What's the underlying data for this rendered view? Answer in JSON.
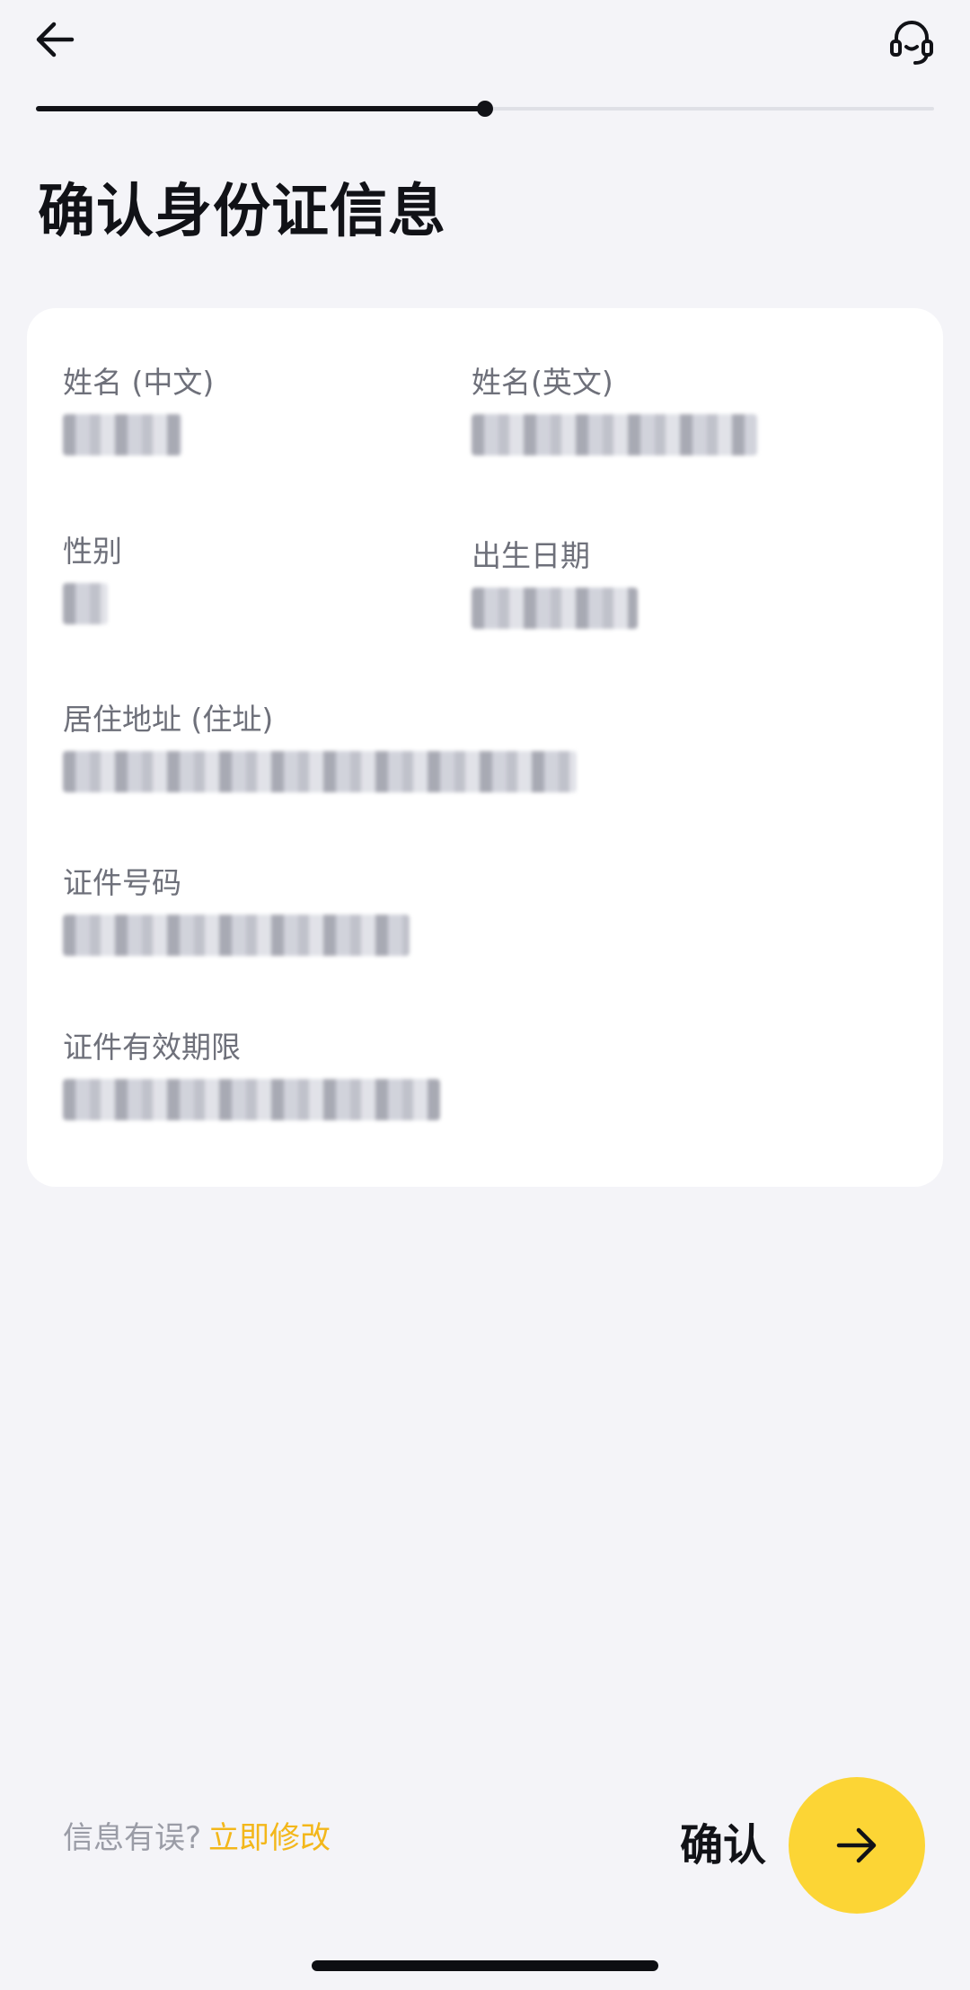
{
  "header": {
    "back_icon": "arrow-left-icon",
    "support_icon": "headset-icon"
  },
  "progress": {
    "fraction": 0.5
  },
  "page_title": "确认身份证信息",
  "fields": {
    "name_cn": {
      "label": "姓名 (中文)",
      "value": ""
    },
    "name_en": {
      "label": "姓名(英文)",
      "value": ""
    },
    "gender": {
      "label": "性别",
      "value": ""
    },
    "birth_date": {
      "label": "出生日期",
      "value": ""
    },
    "address": {
      "label": "居住地址 (住址)",
      "value": ""
    },
    "id_number": {
      "label": "证件号码",
      "value": ""
    },
    "validity": {
      "label": "证件有效期限",
      "value": ""
    }
  },
  "footer": {
    "hint": "信息有误?",
    "edit_link": "立即修改",
    "confirm_label": "确认",
    "confirm_icon": "arrow-right-icon"
  },
  "colors": {
    "accent": "#fcd535",
    "link": "#f3b71a",
    "background": "#f4f4f8",
    "card": "#ffffff",
    "text_primary": "#111217",
    "text_secondary": "#6e707a"
  }
}
